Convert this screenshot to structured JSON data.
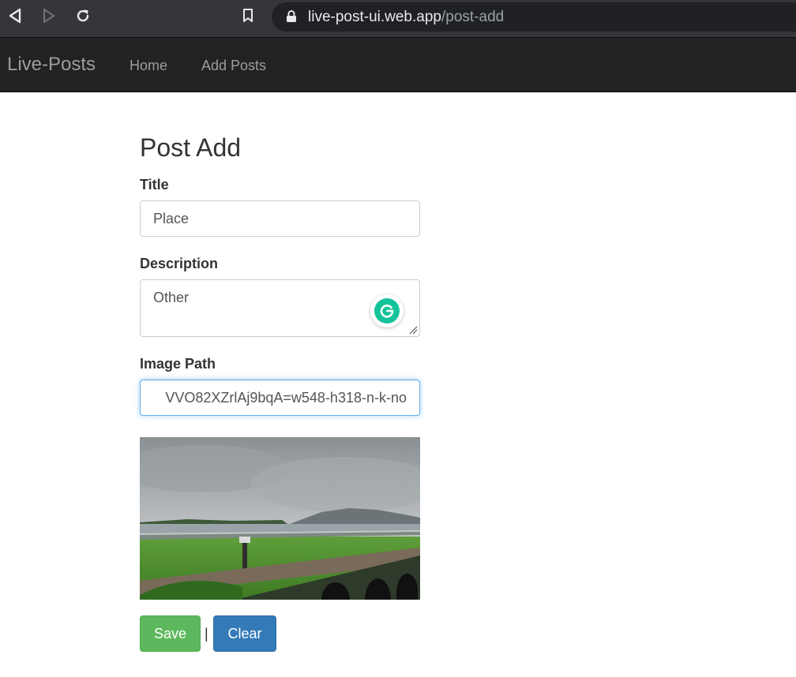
{
  "browser": {
    "url_host": "live-post-ui.web.app",
    "url_path": "/post-add"
  },
  "navbar": {
    "brand": "Live-Posts",
    "links": [
      "Home",
      "Add Posts"
    ]
  },
  "form": {
    "heading": "Post Add",
    "title_label": "Title",
    "title_value": "Place",
    "description_label": "Description",
    "description_value": "Other",
    "image_label": "Image Path",
    "image_value_visible": "VVO82XZrlAj9bqA=w548-h318-n-k-no",
    "save_label": "Save",
    "separator": "|",
    "clear_label": "Clear"
  },
  "icons": {
    "back": "back-icon",
    "forward": "forward-icon",
    "reload": "reload-icon",
    "bookmark": "bookmark-icon",
    "lock": "lock-icon",
    "grammarly": "grammarly-icon"
  },
  "colors": {
    "navbar_bg": "#222222",
    "save_btn": "#5cb85c",
    "clear_btn": "#337ab7",
    "focus_border": "#66afe9"
  }
}
